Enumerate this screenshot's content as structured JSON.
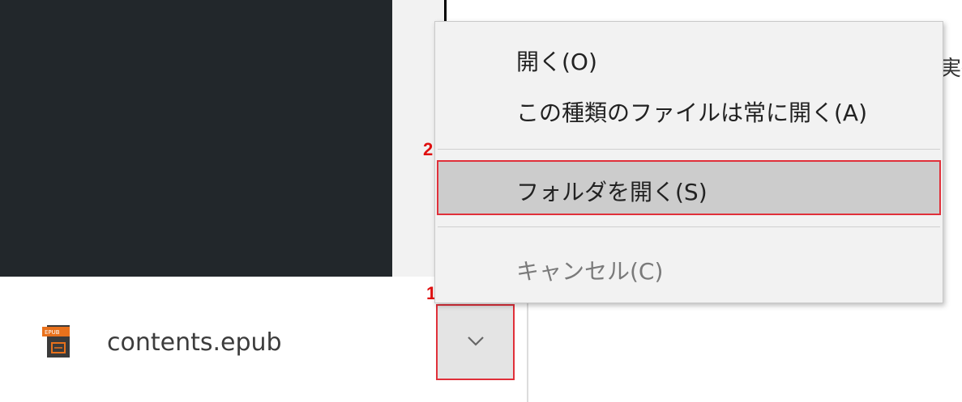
{
  "context_menu": {
    "items": [
      {
        "label": "開く(O)",
        "enabled": true
      },
      {
        "label": "この種類のファイルは常に開く(A)",
        "enabled": true
      },
      {
        "label": "フォルダを開く(S)",
        "enabled": true,
        "highlighted": true
      },
      {
        "label": "キャンセル(C)",
        "enabled": false
      }
    ]
  },
  "download_shelf": {
    "file_name": "contents.epub",
    "file_icon": "epub-file-icon",
    "chevron_icon": "chevron-down-icon"
  },
  "background": {
    "partial_text": "実行"
  },
  "annotations": {
    "marker_1": "1",
    "marker_2": "2",
    "highlight_color": "#e0303a"
  }
}
